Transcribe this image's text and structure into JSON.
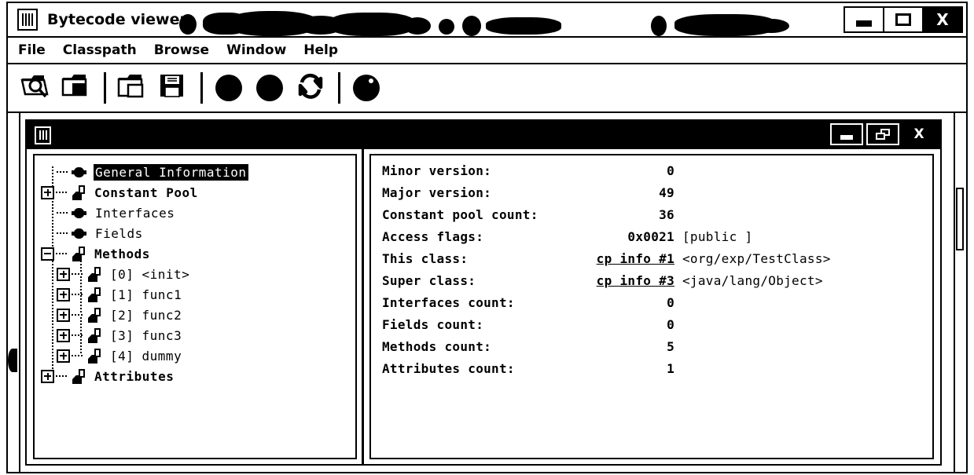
{
  "window": {
    "title": "Bytecode viewer",
    "app_icon": "class-file-icon",
    "title_redacted": true,
    "controls": {
      "minimize": "minimize-button",
      "maximize": "maximize-button",
      "close_label": "X"
    }
  },
  "menu": {
    "items": [
      {
        "label": "File"
      },
      {
        "label": "Classpath"
      },
      {
        "label": "Browse"
      },
      {
        "label": "Window"
      },
      {
        "label": "Help"
      }
    ]
  },
  "toolbar": {
    "buttons": [
      {
        "icon": "open-class-file-icon",
        "kind": "folder-search"
      },
      {
        "icon": "open-classpath-icon",
        "kind": "folder-dot"
      },
      {
        "icon": "new-window-icon",
        "kind": "folder-new"
      },
      {
        "icon": "save-icon",
        "kind": "floppy"
      },
      {
        "icon": "back-icon",
        "kind": "circle"
      },
      {
        "icon": "forward-icon",
        "kind": "circle"
      },
      {
        "icon": "reload-icon",
        "kind": "refresh"
      },
      {
        "icon": "help-icon",
        "kind": "circle-dot"
      }
    ]
  },
  "child_window": {
    "title": "",
    "icon": "class-file-icon",
    "controls": {
      "minimize": "minimize-button",
      "restore": "restore-button",
      "close_label": "X"
    }
  },
  "tree": {
    "nodes": [
      {
        "label": "General Information",
        "level": 0,
        "icon": "leaf",
        "handle": "none",
        "selected": true,
        "bold": false
      },
      {
        "label": "Constant Pool",
        "level": 0,
        "icon": "branch",
        "handle": "plus",
        "selected": false,
        "bold": true
      },
      {
        "label": "Interfaces",
        "level": 0,
        "icon": "leaf",
        "handle": "none",
        "selected": false,
        "bold": false
      },
      {
        "label": "Fields",
        "level": 0,
        "icon": "leaf",
        "handle": "none",
        "selected": false,
        "bold": false
      },
      {
        "label": "Methods",
        "level": 0,
        "icon": "branch",
        "handle": "minus",
        "selected": false,
        "bold": true
      },
      {
        "label": "[0] <init>",
        "level": 1,
        "icon": "branch",
        "handle": "plus",
        "selected": false,
        "bold": false
      },
      {
        "label": "[1] func1",
        "level": 1,
        "icon": "branch",
        "handle": "plus",
        "selected": false,
        "bold": false
      },
      {
        "label": "[2] func2",
        "level": 1,
        "icon": "branch",
        "handle": "plus",
        "selected": false,
        "bold": false
      },
      {
        "label": "[3] func3",
        "level": 1,
        "icon": "branch",
        "handle": "plus",
        "selected": false,
        "bold": false
      },
      {
        "label": "[4] dummy",
        "level": 1,
        "icon": "branch",
        "handle": "plus",
        "selected": false,
        "bold": false
      },
      {
        "label": "Attributes",
        "level": 0,
        "icon": "branch",
        "handle": "plus",
        "selected": false,
        "bold": true
      }
    ]
  },
  "detail": {
    "rows": [
      {
        "key": "Minor version:",
        "value": "0",
        "extra": "",
        "link": false
      },
      {
        "key": "Major version:",
        "value": "49",
        "extra": "",
        "link": false
      },
      {
        "key": "Constant pool count:",
        "value": "36",
        "extra": "",
        "link": false
      },
      {
        "key": "Access flags:",
        "value": "0x0021",
        "extra": "[public ]",
        "link": false
      },
      {
        "key": "This class:",
        "value": "cp info #1",
        "extra": "<org/exp/TestClass>",
        "link": true
      },
      {
        "key": "Super class:",
        "value": "cp info #3",
        "extra": "<java/lang/Object>",
        "link": true
      },
      {
        "key": "Interfaces count:",
        "value": "0",
        "extra": "",
        "link": false
      },
      {
        "key": "Fields count:",
        "value": "0",
        "extra": "",
        "link": false
      },
      {
        "key": "Methods count:",
        "value": "5",
        "extra": "",
        "link": false
      },
      {
        "key": "Attributes count:",
        "value": "1",
        "extra": "",
        "link": false
      }
    ]
  },
  "colors": {
    "background": "#ffffff",
    "foreground": "#000000",
    "selection_bg": "#000000",
    "selection_fg": "#ffffff",
    "titlebar_active_bg": "#000000"
  }
}
